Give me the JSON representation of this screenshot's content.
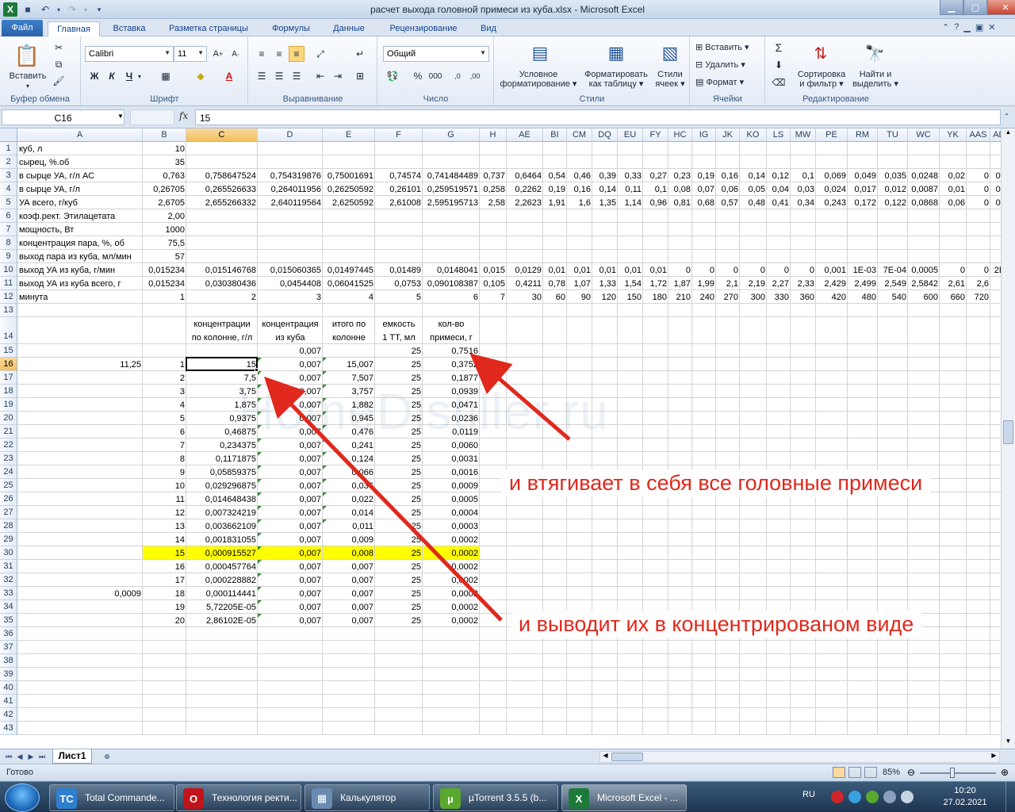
{
  "window": {
    "title": "расчет выхода головной примеси из куба.xlsx  -  Microsoft Excel"
  },
  "tabs": [
    "Файл",
    "Главная",
    "Вставка",
    "Разметка страницы",
    "Формулы",
    "Данные",
    "Рецензирование",
    "Вид"
  ],
  "ribbon": {
    "clipboard": {
      "paste": "Вставить",
      "label": "Буфер обмена"
    },
    "font": {
      "name": "Calibri",
      "size": "11",
      "bold": "Ж",
      "italic": "К",
      "underline": "Ч",
      "label": "Шрифт"
    },
    "alignment": {
      "label": "Выравнивание"
    },
    "number": {
      "format": "Общий",
      "label": "Число"
    },
    "styles": {
      "cond_line1": "Условное",
      "cond_line2": "форматирование",
      "table_line1": "Форматировать",
      "table_line2": "как таблицу",
      "cell_line1": "Стили",
      "cell_line2": "ячеек",
      "label": "Стили"
    },
    "cells": {
      "insert": "Вставить",
      "delete": "Удалить",
      "format": "Формат",
      "label": "Ячейки"
    },
    "editing": {
      "sort_line1": "Сортировка",
      "sort_line2": "и фильтр",
      "find_line1": "Найти и",
      "find_line2": "выделить",
      "label": "Редактирование"
    }
  },
  "formula_bar": {
    "name_box": "C16",
    "fx": "fx",
    "value": "15"
  },
  "sheet": {
    "columns": [
      "A",
      "B",
      "C",
      "D",
      "E",
      "F",
      "G",
      "H",
      "AE",
      "BI",
      "CM",
      "DQ",
      "EU",
      "FY",
      "HC",
      "IG",
      "JK",
      "KO",
      "LS",
      "MW",
      "PE",
      "RM",
      "TU",
      "WC",
      "YK",
      "AAS",
      "ADA"
    ],
    "rows": [
      "1",
      "2",
      "3",
      "4",
      "5",
      "6",
      "7",
      "8",
      "9",
      "10",
      "11",
      "12",
      "13",
      "14",
      "15",
      "16",
      "17",
      "18",
      "19",
      "20",
      "21",
      "22",
      "23",
      "24",
      "25",
      "26",
      "27",
      "28",
      "29",
      "30",
      "31",
      "32",
      "33",
      "34",
      "35",
      "36",
      "37",
      "38",
      "39",
      "40",
      "41",
      "42",
      "43"
    ],
    "top_labels": {
      "r1": "куб, л",
      "r2": "сырец, %.об",
      "r3": "в сырце УА, г/л АС",
      "r4": "в сырце УА, г/л",
      "r5": "УА всего, г/куб",
      "r6": "коэф.рект. Этилацетата",
      "r7": "мощность, Вт",
      "r8": "концентрация пара, %, об",
      "r9": "выход пара из куба, мл/мин",
      "r10": "выход УА из куба, г/мин",
      "r11": "выход УА из куба всего, г",
      "r12": "минута"
    },
    "b_values": {
      "r1": "10",
      "r2": "35",
      "r3": "0,763",
      "r4": "0,26705",
      "r5": "2,6705",
      "r6": "2,00",
      "r7": "1000",
      "r8": "75,5",
      "r9": "57",
      "r10": "0,015234",
      "r11": "0,015234",
      "r12": "1"
    },
    "row3": [
      "0,758647524",
      "0,754319876",
      "0,75001691",
      "0,74574",
      "0,741484489",
      "0,737",
      "0,6464",
      "0,54",
      "0,46",
      "0,39",
      "0,33",
      "0,27",
      "0,23",
      "0,19",
      "0,16",
      "0,14",
      "0,12",
      "0,1",
      "0,069",
      "0,049",
      "0,035",
      "0,0248",
      "0,02",
      "0",
      "0,00"
    ],
    "row4": [
      "0,265526633",
      "0,264011956",
      "0,26250592",
      "0,26101",
      "0,259519571",
      "0,258",
      "0,2262",
      "0,19",
      "0,16",
      "0,14",
      "0,11",
      "0,1",
      "0,08",
      "0,07",
      "0,06",
      "0,05",
      "0,04",
      "0,03",
      "0,024",
      "0,017",
      "0,012",
      "0,0087",
      "0,01",
      "0",
      "0,00"
    ],
    "row5": [
      "2,655266332",
      "2,640119564",
      "2,6250592",
      "2,61008",
      "2,595195713",
      "2,58",
      "2,2623",
      "1,91",
      "1,6",
      "1,35",
      "1,14",
      "0,96",
      "0,81",
      "0,68",
      "0,57",
      "0,48",
      "0,41",
      "0,34",
      "0,243",
      "0,172",
      "0,122",
      "0,0868",
      "0,06",
      "0",
      "0,03"
    ],
    "row10": [
      "0,015146768",
      "0,015060365",
      "0,01497445",
      "0,01489",
      "0,0148041",
      "0,015",
      "0,0129",
      "0,01",
      "0,01",
      "0,01",
      "0,01",
      "0,01",
      "0",
      "0",
      "0",
      "0",
      "0",
      "0",
      "0,001",
      "1E-03",
      "7E-04",
      "0,0005",
      "0",
      "0",
      "2E-0"
    ],
    "row11": [
      "0,030380436",
      "0,0454408",
      "0,06041525",
      "0,0753",
      "0,090108387",
      "0,105",
      "0,4211",
      "0,78",
      "1,07",
      "1,33",
      "1,54",
      "1,72",
      "1,87",
      "1,99",
      "2,1",
      "2,19",
      "2,27",
      "2,33",
      "2,429",
      "2,499",
      "2,549",
      "2,5842",
      "2,61",
      "2,6",
      "2,6"
    ],
    "row12": [
      "2",
      "3",
      "4",
      "5",
      "6",
      "7",
      "30",
      "60",
      "90",
      "120",
      "150",
      "180",
      "210",
      "240",
      "270",
      "300",
      "330",
      "360",
      "420",
      "480",
      "540",
      "600",
      "660",
      "720",
      "78"
    ],
    "header14": {
      "c_line1": "концентрации",
      "c_line2": "по колонне, г/л",
      "d_line1": "концентрация",
      "d_line2": "из куба",
      "e_line1": "итого по",
      "e_line2": "колонне",
      "f_line1": "емкость",
      "f_line2": "1 ТТ, мл",
      "g_line1": "кол-во",
      "g_line2": "примеси, г"
    },
    "row15": {
      "d": "0,007",
      "f": "25",
      "g": "0,7516"
    },
    "a16": "11,25",
    "a33": "0,0009",
    "table": [
      {
        "b": "1",
        "c": "15",
        "d": "0,007",
        "e": "15,007",
        "f": "25",
        "g": "0,3752"
      },
      {
        "b": "2",
        "c": "7,5",
        "d": "0,007",
        "e": "7,507",
        "f": "25",
        "g": "0,1877"
      },
      {
        "b": "3",
        "c": "3,75",
        "d": "0,007",
        "e": "3,757",
        "f": "25",
        "g": "0,0939"
      },
      {
        "b": "4",
        "c": "1,875",
        "d": "0,007",
        "e": "1,882",
        "f": "25",
        "g": "0,0471"
      },
      {
        "b": "5",
        "c": "0,9375",
        "d": "0,007",
        "e": "0,945",
        "f": "25",
        "g": "0,0236"
      },
      {
        "b": "6",
        "c": "0,46875",
        "d": "0,007",
        "e": "0,476",
        "f": "25",
        "g": "0,0119"
      },
      {
        "b": "7",
        "c": "0,234375",
        "d": "0,007",
        "e": "0,241",
        "f": "25",
        "g": "0,0060"
      },
      {
        "b": "8",
        "c": "0,1171875",
        "d": "0,007",
        "e": "0,124",
        "f": "25",
        "g": "0,0031"
      },
      {
        "b": "9",
        "c": "0,05859375",
        "d": "0,007",
        "e": "0,066",
        "f": "25",
        "g": "0,0016"
      },
      {
        "b": "10",
        "c": "0,029296875",
        "d": "0,007",
        "e": "0,036",
        "f": "25",
        "g": "0,0009"
      },
      {
        "b": "11",
        "c": "0,014648438",
        "d": "0,007",
        "e": "0,022",
        "f": "25",
        "g": "0,0005"
      },
      {
        "b": "12",
        "c": "0,007324219",
        "d": "0,007",
        "e": "0,014",
        "f": "25",
        "g": "0,0004"
      },
      {
        "b": "13",
        "c": "0,003662109",
        "d": "0,007",
        "e": "0,011",
        "f": "25",
        "g": "0,0003"
      },
      {
        "b": "14",
        "c": "0,001831055",
        "d": "0,007",
        "e": "0,009",
        "f": "25",
        "g": "0,0002"
      },
      {
        "b": "15",
        "c": "0,000915527",
        "d": "0,007",
        "e": "0,008",
        "f": "25",
        "g": "0,0002"
      },
      {
        "b": "16",
        "c": "0,000457764",
        "d": "0,007",
        "e": "0,007",
        "f": "25",
        "g": "0,0002"
      },
      {
        "b": "17",
        "c": "0,000228882",
        "d": "0,007",
        "e": "0,007",
        "f": "25",
        "g": "0,0002"
      },
      {
        "b": "18",
        "c": "0,000114441",
        "d": "0,007",
        "e": "0,007",
        "f": "25",
        "g": "0,0002"
      },
      {
        "b": "19",
        "c": "5,72205E-05",
        "d": "0,007",
        "e": "0,007",
        "f": "25",
        "g": "0,0002"
      },
      {
        "b": "20",
        "c": "2,86102E-05",
        "d": "0,007",
        "e": "0,007",
        "f": "25",
        "g": "0,0002"
      }
    ],
    "highlight_row": "30",
    "watermark": "HomeDistiller.ru",
    "annotations": {
      "top": "и втягивает в себя все головные примеси",
      "bottom": "и выводит их в концентрированом виде"
    },
    "arrow_color": "#e0281c",
    "highlight_color": "#ffff00"
  },
  "sheet_tab": "Лист1",
  "status": {
    "ready": "Готово",
    "zoom": "85%"
  },
  "taskbar": {
    "items": [
      {
        "label": "Total Commande...",
        "color": "#2f7fd0",
        "glyph": "TC"
      },
      {
        "label": "Технология ректи...",
        "color": "#c0141a",
        "glyph": "O"
      },
      {
        "label": "Калькулятор",
        "color": "#6a8ab0",
        "glyph": "▦"
      },
      {
        "label": "µTorrent 3.5.5  (b...",
        "color": "#5aa82e",
        "glyph": "µ"
      },
      {
        "label": "Microsoft Excel - ...",
        "color": "#1d7a3a",
        "glyph": "X"
      }
    ],
    "lang": "RU",
    "time": "10:20",
    "date": "27.02.2021"
  }
}
